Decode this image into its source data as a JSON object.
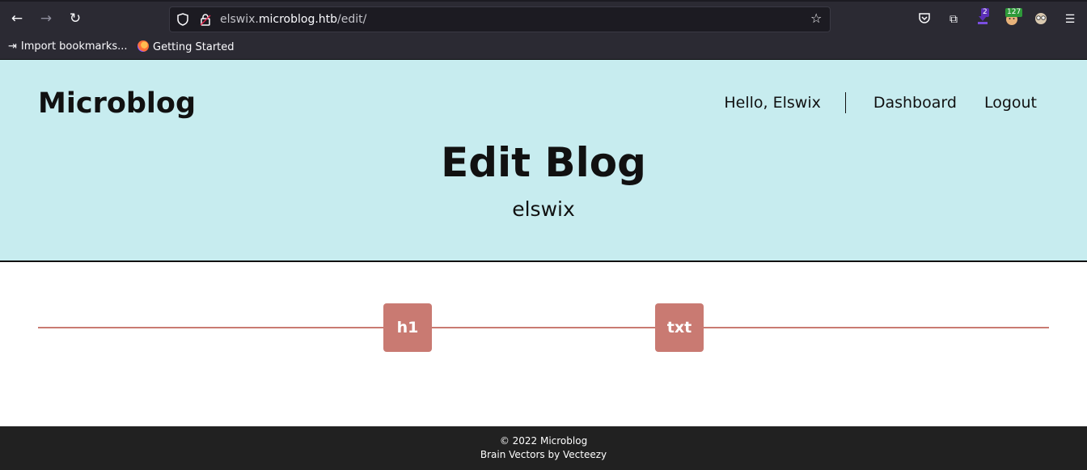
{
  "browser": {
    "url_prefix": "elswix.",
    "url_host": "microblog.htb",
    "url_path": "/edit/",
    "extensions": {
      "badge1": "2",
      "badge2": "127"
    }
  },
  "bookmarks": {
    "import_label": "Import bookmarks...",
    "getting_started_label": "Getting Started"
  },
  "header": {
    "brand": "Microblog",
    "greeting": "Hello, Elswix",
    "dashboard_label": "Dashboard",
    "logout_label": "Logout",
    "title": "Edit Blog",
    "subtitle": "elswix"
  },
  "editor": {
    "h1_button_label": "h1",
    "txt_button_label": "txt",
    "accent_color": "#c97a72"
  },
  "footer": {
    "copyright": "© 2022 Microblog",
    "credit": "Brain Vectors by Vecteezy"
  },
  "colors": {
    "header_bg": "#c7ecef",
    "footer_bg": "#212121",
    "chrome_bg": "#2b2a33"
  }
}
